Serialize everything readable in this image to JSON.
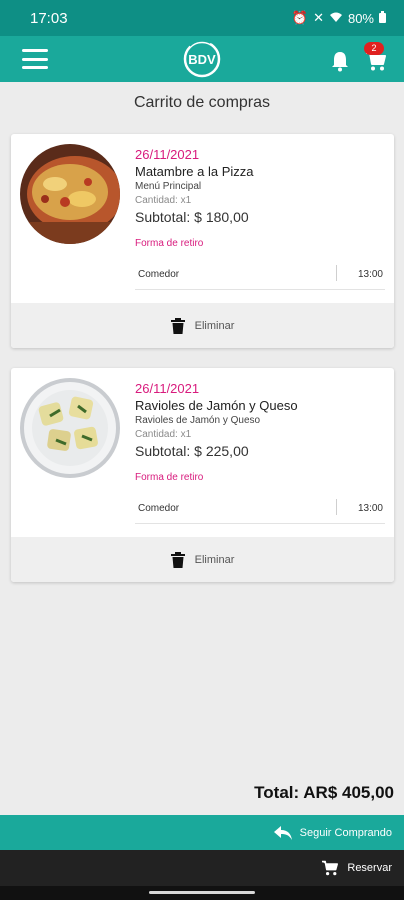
{
  "status_bar": {
    "time": "17:03",
    "battery": "80%"
  },
  "header": {
    "logo_text": "BDV",
    "cart_count": "2"
  },
  "page_title": "Carrito de compras",
  "items": [
    {
      "date": "26/11/2021",
      "name": "Matambre a la Pizza",
      "category": "Menú Principal",
      "quantity": "Cantidad: x1",
      "subtotal": "Subtotal: $ 180,00",
      "pickup_label": "Forma de retiro",
      "pickup_place": "Comedor",
      "pickup_time": "13:00",
      "delete_label": "Eliminar"
    },
    {
      "date": "26/11/2021",
      "name": "Ravioles de Jamón y Queso",
      "category": "Ravioles de Jamón y Queso",
      "quantity": "Cantidad: x1",
      "subtotal": "Subtotal: $ 225,00",
      "pickup_label": "Forma de retiro",
      "pickup_place": "Comedor",
      "pickup_time": "13:00",
      "delete_label": "Eliminar"
    }
  ],
  "total": "Total: AR$ 405,00",
  "actions": {
    "continue_label": "Seguir Comprando",
    "reserve_label": "Reservar"
  },
  "colors": {
    "primary": "#1aa99b",
    "accent": "#d81b7d",
    "badge": "#e0201f",
    "dark_bar": "#222222"
  }
}
